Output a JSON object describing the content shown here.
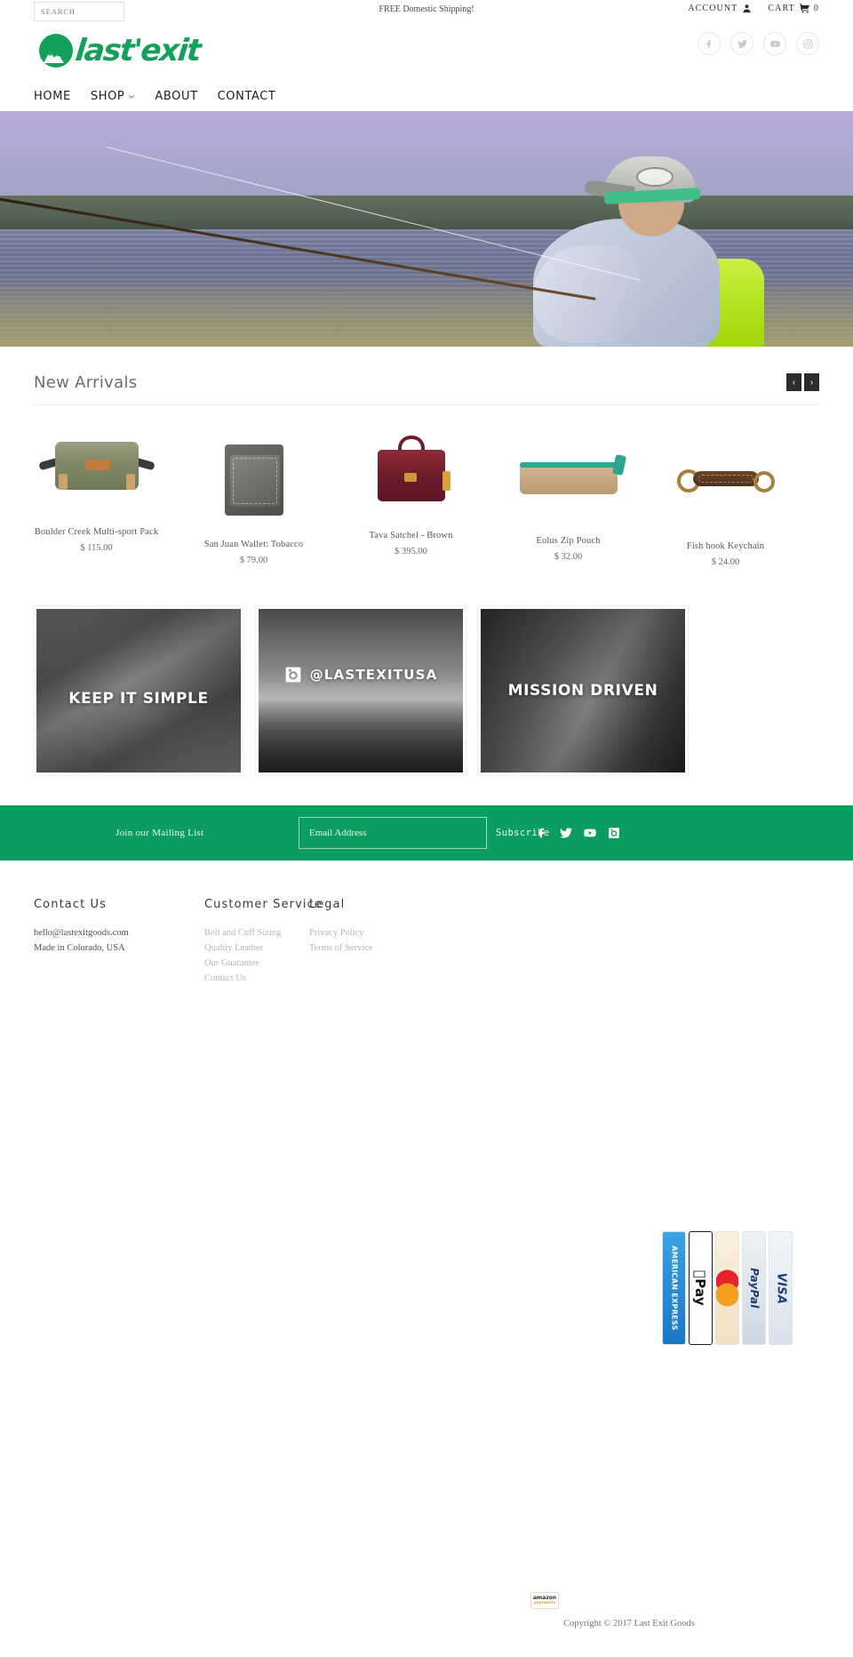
{
  "topbar": {
    "search_placeholder": "SEARCH",
    "search_value": "",
    "shipping_message": "FREE Domestic Shipping!",
    "account_label": "ACCOUNT",
    "cart_label": "CART",
    "cart_count": "0"
  },
  "brand": {
    "name": "last'exit",
    "social": [
      {
        "name": "facebook-icon",
        "label": "Facebook"
      },
      {
        "name": "twitter-icon",
        "label": "Twitter"
      },
      {
        "name": "youtube-icon",
        "label": "YouTube"
      },
      {
        "name": "instagram-icon",
        "label": "Instagram"
      }
    ]
  },
  "nav": {
    "items": [
      {
        "label": "HOME",
        "has_dropdown": false
      },
      {
        "label": "SHOP",
        "has_dropdown": true
      },
      {
        "label": "ABOUT",
        "has_dropdown": false
      },
      {
        "label": "CONTACT",
        "has_dropdown": false
      }
    ]
  },
  "new_arrivals": {
    "title": "New Arrivals",
    "prev_label": "‹",
    "next_label": "›",
    "products": [
      {
        "title": "Boulder Creek Multi-sport Pack",
        "price": "$ 115.00"
      },
      {
        "title": "San Juan Wallet: Tobacco",
        "price": "$ 79.00"
      },
      {
        "title": "Tava Satchel - Brown",
        "price": "$ 395.00"
      },
      {
        "title": "Eolus Zip Pouch",
        "price": "$ 32.00"
      },
      {
        "title": "Fish hook Keychain",
        "price": "$ 24.00"
      }
    ]
  },
  "promos": [
    {
      "caption": "KEEP IT SIMPLE",
      "type": "text"
    },
    {
      "caption": "@LASTEXITUSA",
      "type": "instagram"
    },
    {
      "caption": "MISSION DRIVEN",
      "type": "text"
    }
  ],
  "newsletter": {
    "label": "Join our Mailing List",
    "email_placeholder": "Email Address",
    "email_value": "",
    "subscribe_label": "Subscribe",
    "background_color": "#0a9d5e",
    "social": [
      {
        "name": "facebook-icon",
        "label": "Facebook"
      },
      {
        "name": "twitter-icon",
        "label": "Twitter"
      },
      {
        "name": "youtube-icon",
        "label": "YouTube"
      },
      {
        "name": "instagram-icon",
        "label": "Instagram"
      }
    ]
  },
  "footer": {
    "columns": [
      {
        "heading": "Contact Us",
        "items": [
          {
            "text": "hello@lastexitgoods.com",
            "style": "dark"
          },
          {
            "text": "Made in Colorado, USA",
            "style": "dark"
          }
        ]
      },
      {
        "heading": "Customer Service",
        "items": [
          {
            "text": "Belt and Cuff Sizing",
            "style": "link"
          },
          {
            "text": "Quality Leather",
            "style": "link"
          },
          {
            "text": "Our Guarantee",
            "style": "link"
          },
          {
            "text": "Contact Us",
            "style": "link"
          }
        ]
      },
      {
        "heading": "Legal",
        "items": [
          {
            "text": "Privacy Policy",
            "style": "link"
          },
          {
            "text": "Terms of Service",
            "style": "link"
          }
        ]
      }
    ],
    "payment_methods": [
      {
        "name": "american-express",
        "label": "AMERICAN EXPRESS"
      },
      {
        "name": "apple-pay",
        "label": "Pay"
      },
      {
        "name": "mastercard",
        "label": "MasterCard"
      },
      {
        "name": "paypal",
        "label": "PayPal"
      },
      {
        "name": "visa",
        "label": "VISA"
      }
    ],
    "amazon_badge": {
      "line1": "amazon",
      "line2": "payments"
    },
    "copyright": "Copyright © 2017 Last Exit Goods"
  }
}
